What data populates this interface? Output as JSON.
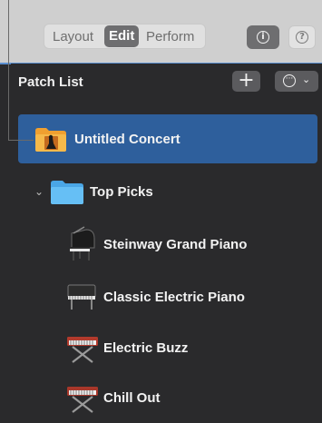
{
  "mode_selector": {
    "layout_label": "Layout",
    "edit_label": "Edit",
    "perform_label": "Perform",
    "selected": "Edit"
  },
  "header_buttons": {
    "info_glyph": "i",
    "help_glyph": "?"
  },
  "patch_list": {
    "title": "Patch List",
    "add_glyph": "+",
    "more_glyph": "···",
    "chevron_glyph": "⌄",
    "disclosure_glyph": "⌄",
    "items": [
      {
        "label": "Untitled Concert",
        "icon": "concert-folder-icon",
        "selected": true
      },
      {
        "label": "Top Picks",
        "icon": "folder-icon",
        "expanded": true
      },
      {
        "label": "Steinway Grand Piano",
        "icon": "grand-piano-icon"
      },
      {
        "label": "Classic Electric Piano",
        "icon": "electric-piano-icon"
      },
      {
        "label": "Electric Buzz",
        "icon": "keyboard-stand-icon"
      },
      {
        "label": "Chill Out",
        "icon": "keyboard-stand-icon"
      }
    ]
  },
  "colors": {
    "selection": "#2e5f9c",
    "folder": "#5ab4f0",
    "accent_line": "#5a8fd0"
  }
}
